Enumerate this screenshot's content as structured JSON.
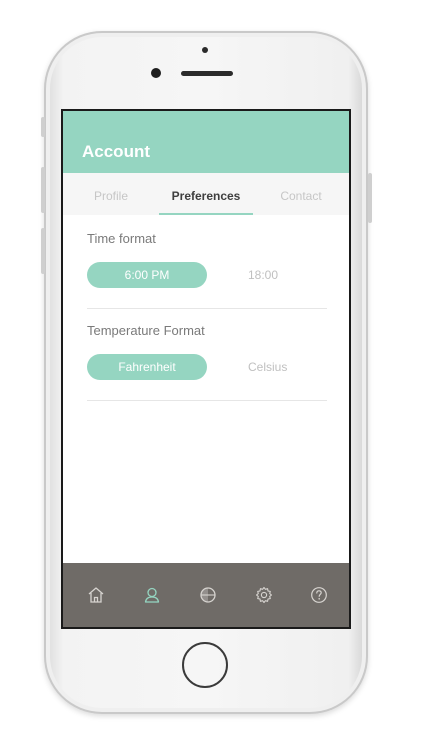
{
  "app": {
    "title": "Account"
  },
  "tabs": [
    {
      "label": "Profile",
      "active": false
    },
    {
      "label": "Preferences",
      "active": true
    },
    {
      "label": "Contact",
      "active": false
    }
  ],
  "preferences": {
    "time_format": {
      "label": "Time format",
      "selected": "6:00 PM",
      "alternative": "18:00"
    },
    "temperature_format": {
      "label": "Temperature Format",
      "selected": "Fahrenheit",
      "alternative": "Celsius"
    }
  },
  "bottom_nav": [
    {
      "icon": "home-icon",
      "active": false
    },
    {
      "icon": "user-icon",
      "active": true
    },
    {
      "icon": "toggle-icon",
      "active": false
    },
    {
      "icon": "gear-icon",
      "active": false
    },
    {
      "icon": "help-icon",
      "active": false
    }
  ],
  "colors": {
    "accent": "#95d5c1",
    "tabbar": "#6f6b67",
    "active_tab_text": "#3f3f3f",
    "inactive_text": "#c6c6c6",
    "label_text": "#7a7a7a"
  }
}
